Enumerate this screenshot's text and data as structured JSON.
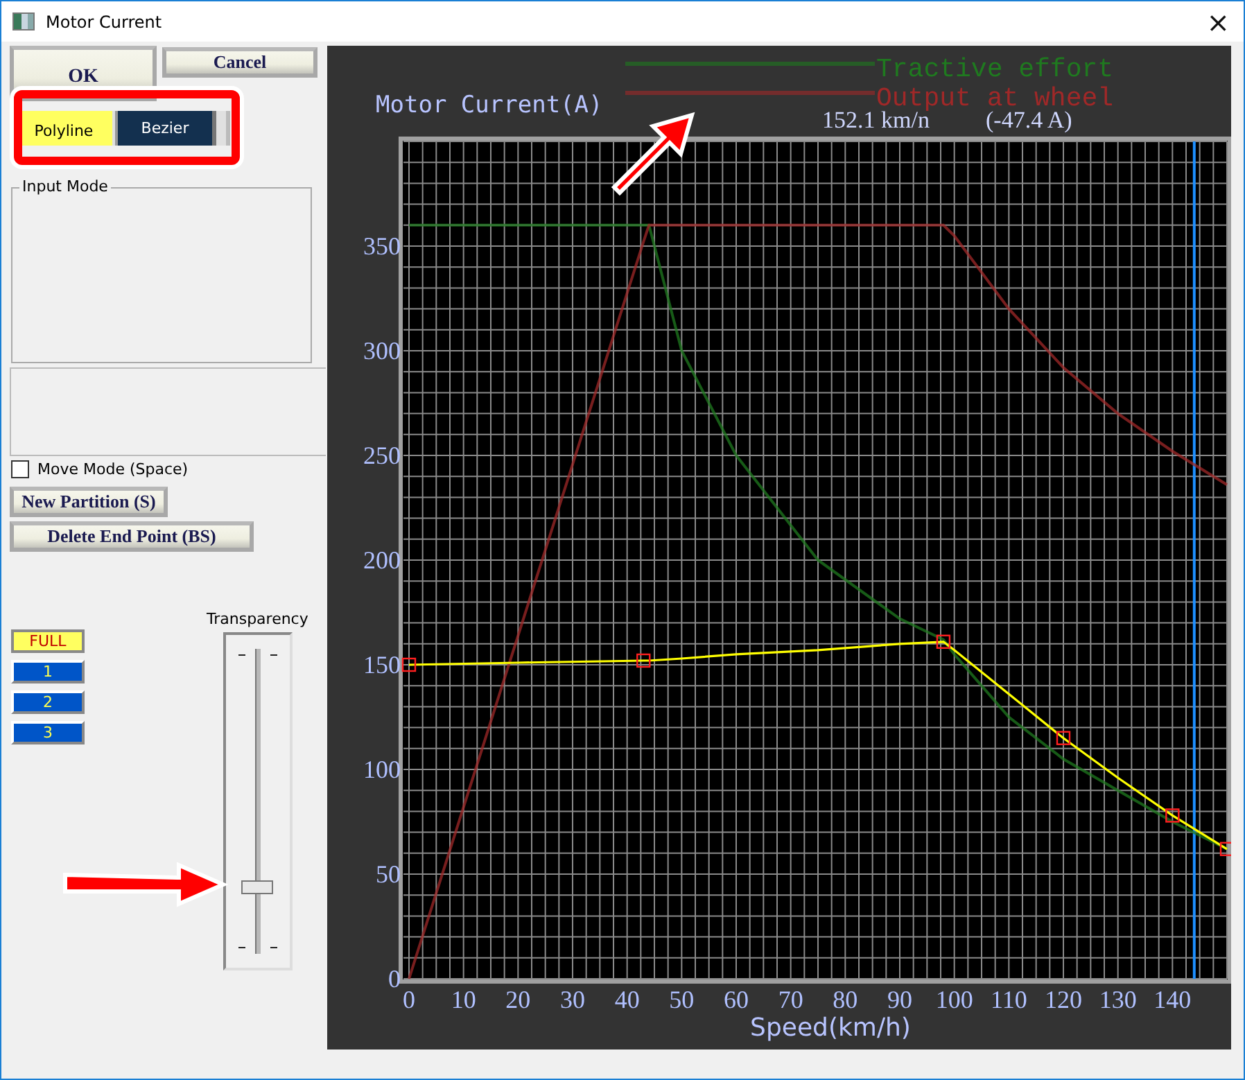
{
  "window": {
    "title": "Motor Current",
    "close": "×"
  },
  "buttons": {
    "ok": "OK",
    "cancel": "Cancel"
  },
  "mode_toggle": [
    {
      "label": "Polyline",
      "selected": true
    },
    {
      "label": "Bezier",
      "selected": false
    }
  ],
  "input_mode": {
    "label": "Input Mode"
  },
  "move_mode": {
    "label": "Move Mode (Space)",
    "checked": false
  },
  "actions": [
    "New Partition (S)",
    "Delete End Point (BS)"
  ],
  "levels": [
    {
      "label": "FULL",
      "selected": true
    },
    {
      "label": "1",
      "selected": false
    },
    {
      "label": "2",
      "selected": false
    },
    {
      "label": "3",
      "selected": false
    }
  ],
  "transparency": {
    "label": "Transparency",
    "level": 0.22
  },
  "chart": {
    "readout_speed": "152.1 km/n",
    "readout_value": "(-47.4 A)",
    "chart_data": {
      "type": "line",
      "title": "Motor Current(A)",
      "xlabel": "Speed(km/h)",
      "x": [
        0,
        20,
        43,
        44,
        50,
        60,
        75,
        90,
        98,
        100,
        110,
        120,
        130,
        140,
        150
      ],
      "series": [
        {
          "name": "Tractive effort",
          "color": "#1f7a1f",
          "values": [
            360,
            360,
            360,
            360,
            300,
            250,
            200,
            172,
            162,
            155,
            125,
            105,
            90,
            75,
            62
          ]
        },
        {
          "name": "Output at wheel",
          "color": "#a02828",
          "values": [
            0,
            164,
            352,
            360,
            360,
            360,
            360,
            360,
            360,
            355,
            320,
            292,
            270,
            252,
            236
          ]
        },
        {
          "color": "#ffff00",
          "values": [
            150,
            151,
            152,
            152,
            153,
            155,
            157,
            160,
            161,
            157,
            136,
            115,
            96,
            78,
            62
          ]
        },
        {
          "color": "#ff2020",
          "values": [
            150,
            null,
            152,
            null,
            null,
            null,
            null,
            null,
            161,
            null,
            null,
            115,
            null,
            78,
            62
          ],
          "type": "scatter",
          "marker": "square"
        }
      ],
      "xlim": [
        0,
        150
      ],
      "ylim": [
        0,
        400
      ],
      "xticks": [
        0,
        10,
        20,
        30,
        40,
        50,
        60,
        70,
        80,
        90,
        100,
        110,
        120,
        130,
        140
      ],
      "yticks": [
        0,
        50,
        100,
        150,
        200,
        250,
        300,
        350
      ],
      "grid": true,
      "ref_lines": [
        {
          "axis": "x",
          "value": 144,
          "color": "#1e90ff"
        }
      ]
    }
  },
  "annotations": [
    {
      "kind": "highlight-box"
    },
    {
      "kind": "arrow"
    },
    {
      "kind": "arrow"
    }
  ]
}
